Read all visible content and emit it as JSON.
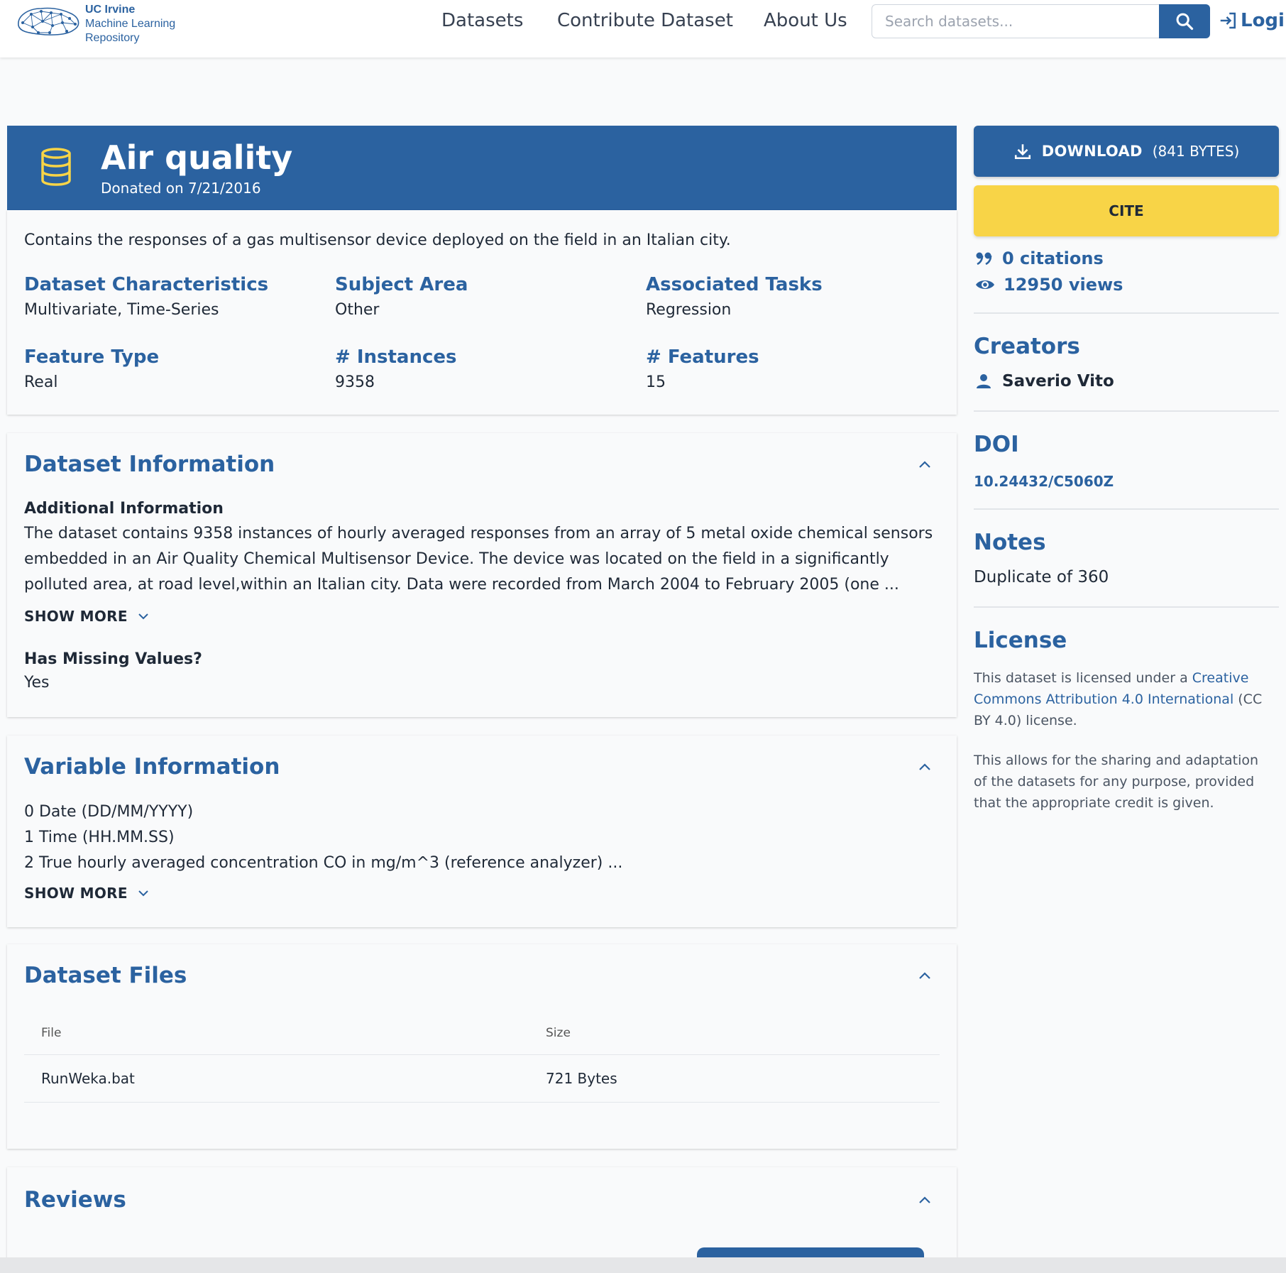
{
  "brand": {
    "line1": "UC Irvine",
    "line2": "Machine Learning",
    "line3": "Repository"
  },
  "nav": {
    "datasets": "Datasets",
    "contribute": "Contribute Dataset",
    "about": "About Us",
    "login": "Login"
  },
  "search": {
    "placeholder": "Search datasets..."
  },
  "dataset": {
    "title": "Air quality",
    "donated": "Donated on 7/21/2016",
    "description": "Contains the responses of a gas multisensor device deployed on the field in an Italian city."
  },
  "properties": [
    {
      "label": "Dataset Characteristics",
      "value": "Multivariate, Time-Series"
    },
    {
      "label": "Subject Area",
      "value": "Other"
    },
    {
      "label": "Associated Tasks",
      "value": "Regression"
    },
    {
      "label": "Feature Type",
      "value": "Real"
    },
    {
      "label": "# Instances",
      "value": "9358"
    },
    {
      "label": "# Features",
      "value": "15"
    }
  ],
  "dataset_info": {
    "title": "Dataset Information",
    "additional_heading": "Additional Information",
    "additional_text_1": "The dataset contains 9358 instances of hourly averaged responses from an array of 5 metal oxide chemical sensors",
    "additional_text_2": "embedded in an Air Quality Chemical Multisensor Device. The device was located on the field in a significantly",
    "additional_text_3": "polluted area, at road level,within an Italian city. Data were recorded from March 2004 to February 2005 (one ...",
    "show_more": "SHOW MORE",
    "missing_heading": "Has Missing Values?",
    "missing_value": "Yes"
  },
  "variable_info": {
    "title": "Variable Information",
    "line1": "0 Date (DD/MM/YYYY)",
    "line2": "1 Time (HH.MM.SS)",
    "line3": "2 True hourly averaged concentration CO in mg/m^3 (reference analyzer) ...",
    "show_more": "SHOW MORE"
  },
  "files": {
    "title": "Dataset Files",
    "col_file": "File",
    "col_size": "Size",
    "rows": [
      {
        "file": "RunWeka.bat",
        "size": "721 Bytes"
      }
    ]
  },
  "reviews": {
    "title": "Reviews"
  },
  "sidebar": {
    "download_label": "DOWNLOAD",
    "download_size": "(841 BYTES)",
    "cite_label": "CITE",
    "citations": "0 citations",
    "views": "12950 views",
    "creators_heading": "Creators",
    "creator": "Saverio Vito",
    "doi_heading": "DOI",
    "doi": "10.24432/C5060Z",
    "notes_heading": "Notes",
    "notes": "Duplicate of 360",
    "license_heading": "License",
    "license_pre": "This dataset is licensed under a ",
    "license_link": "Creative Commons Attribution 4.0 International",
    "license_post": " (CC BY 4.0) license.",
    "license_text2": "This allows for the sharing and adaptation of the datasets for any purpose, provided that the appropriate credit is given."
  },
  "colors": {
    "primary": "#2b62a0",
    "cite": "#f8d447",
    "hero_icon": "#f8d447"
  }
}
